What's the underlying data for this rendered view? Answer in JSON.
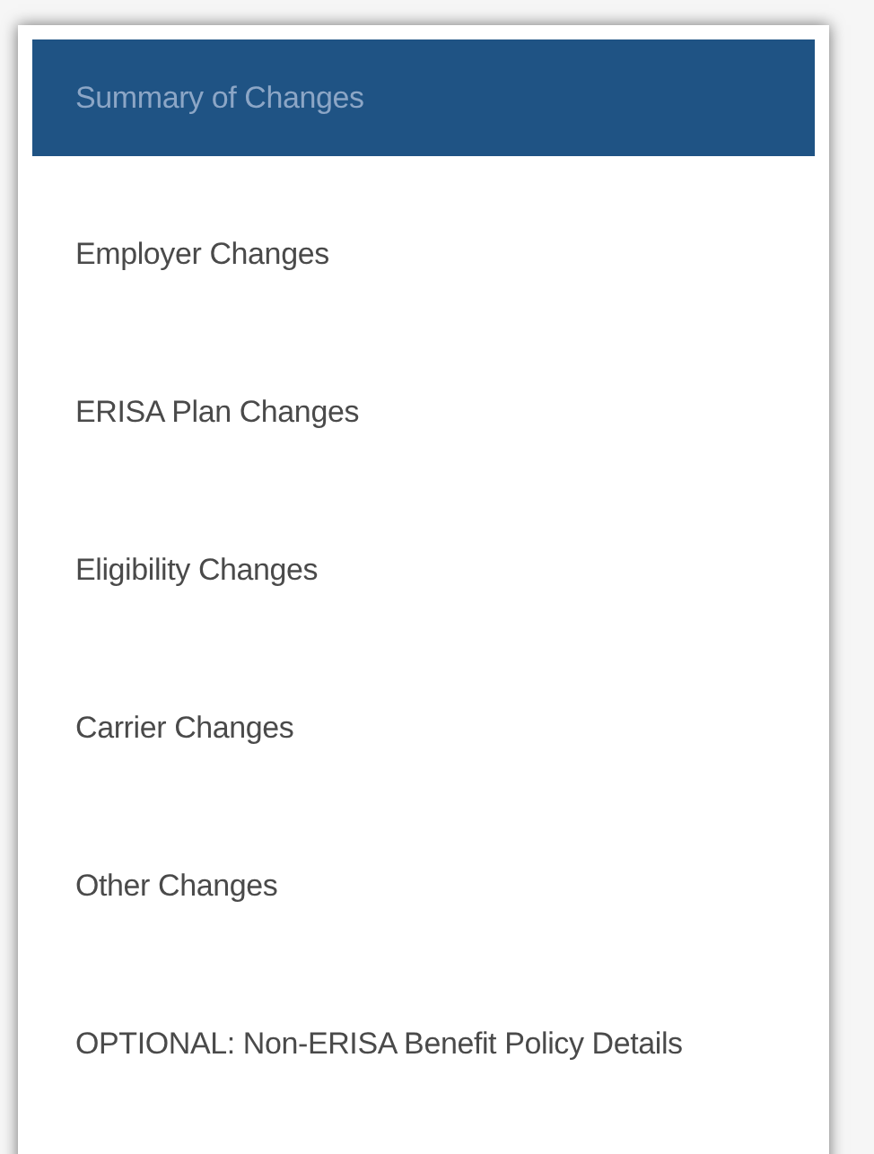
{
  "menu": {
    "items": [
      {
        "label": "Summary of Changes",
        "selected": true
      },
      {
        "label": "Employer Changes",
        "selected": false
      },
      {
        "label": "ERISA Plan Changes",
        "selected": false
      },
      {
        "label": "Eligibility Changes",
        "selected": false
      },
      {
        "label": "Carrier Changes",
        "selected": false
      },
      {
        "label": "Other Changes",
        "selected": false
      },
      {
        "label": "OPTIONAL: Non-ERISA Benefit Policy Details",
        "selected": false
      }
    ]
  }
}
